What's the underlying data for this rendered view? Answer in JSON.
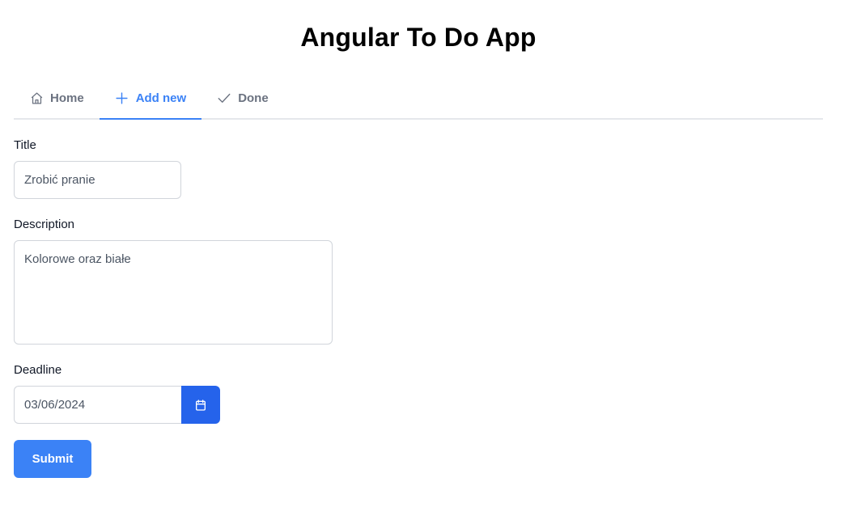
{
  "app": {
    "title": "Angular To Do App"
  },
  "tabs": [
    {
      "label": "Home",
      "icon": "home-icon",
      "active": false
    },
    {
      "label": "Add new",
      "icon": "plus-icon",
      "active": true
    },
    {
      "label": "Done",
      "icon": "check-icon",
      "active": false
    }
  ],
  "form": {
    "title_label": "Title",
    "title_value": "Zrobić pranie",
    "description_label": "Description",
    "description_value": "Kolorowe oraz białe",
    "deadline_label": "Deadline",
    "deadline_value": "03/06/2024",
    "calendar_icon": "calendar-icon",
    "submit_label": "Submit"
  },
  "colors": {
    "accent": "#3b82f6",
    "calendar_button": "#2563eb",
    "tab_inactive": "#6b7280",
    "border": "#d1d5db"
  }
}
